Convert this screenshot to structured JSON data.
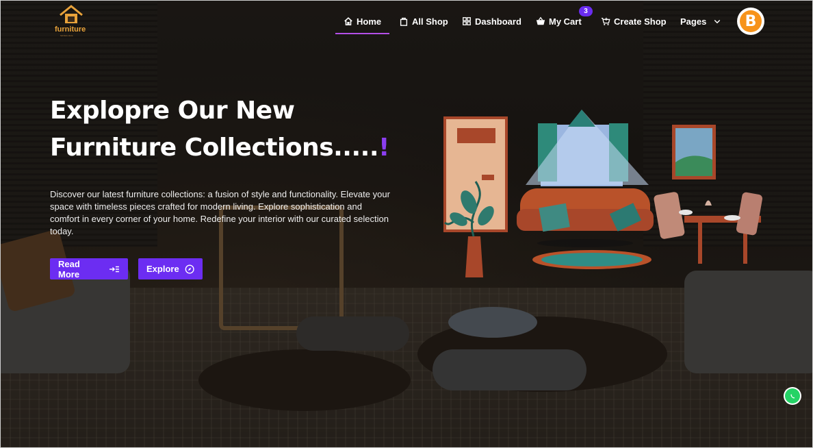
{
  "brand": {
    "name": "furniture",
    "tagline": "furniture store"
  },
  "nav": {
    "items": [
      {
        "label": "Home",
        "icon": "home-icon"
      },
      {
        "label": "All Shop",
        "icon": "shop-bag-icon"
      },
      {
        "label": "Dashboard",
        "icon": "dashboard-icon"
      },
      {
        "label": "My Cart",
        "icon": "cart-basket-icon"
      },
      {
        "label": "Create Shop",
        "icon": "add-cart-icon"
      },
      {
        "label": "Pages",
        "icon": "chevron-down-icon"
      }
    ],
    "cart_count": "3",
    "active": "Home"
  },
  "hero": {
    "title_line1": "Explopre Our New",
    "title_line2": "Furniture Collections.....",
    "title_excl": "!",
    "description": "Discover our latest furniture collections: a fusion of style and functionality. Elevate your space with timeless pieces crafted for modern living. Explore sophistication and comfort in every corner of your home. Redefine your interior with our curated selection today.",
    "read_more": "Read More",
    "explore": "Explore"
  },
  "colors": {
    "accent": "#6c2df2",
    "active_underline": "#b44fe8",
    "logo": "#e8a23a"
  },
  "floating": {
    "whatsapp_icon": "whatsapp-icon",
    "avatar_icon": "bitcoin-icon"
  }
}
